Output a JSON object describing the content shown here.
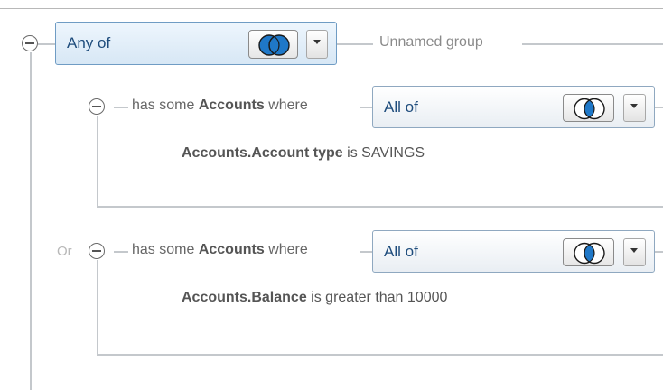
{
  "root": {
    "combo_value": "Any of",
    "group_name": "Unnamed group",
    "venn_mode": "union",
    "venn_color": "#1f78c8"
  },
  "groups": [
    {
      "connector": "",
      "prefix": "has some",
      "entity": "Accounts",
      "suffix": "where",
      "combo_value": "All of",
      "venn_mode": "intersection",
      "condition": {
        "field": "Accounts.Account type",
        "operator": "is",
        "value": "SAVINGS"
      }
    },
    {
      "connector": "Or",
      "prefix": "has some",
      "entity": "Accounts",
      "suffix": "where",
      "combo_value": "All of",
      "venn_mode": "intersection",
      "condition": {
        "field": "Accounts.Balance",
        "operator": "is greater than",
        "value": "10000"
      }
    }
  ]
}
